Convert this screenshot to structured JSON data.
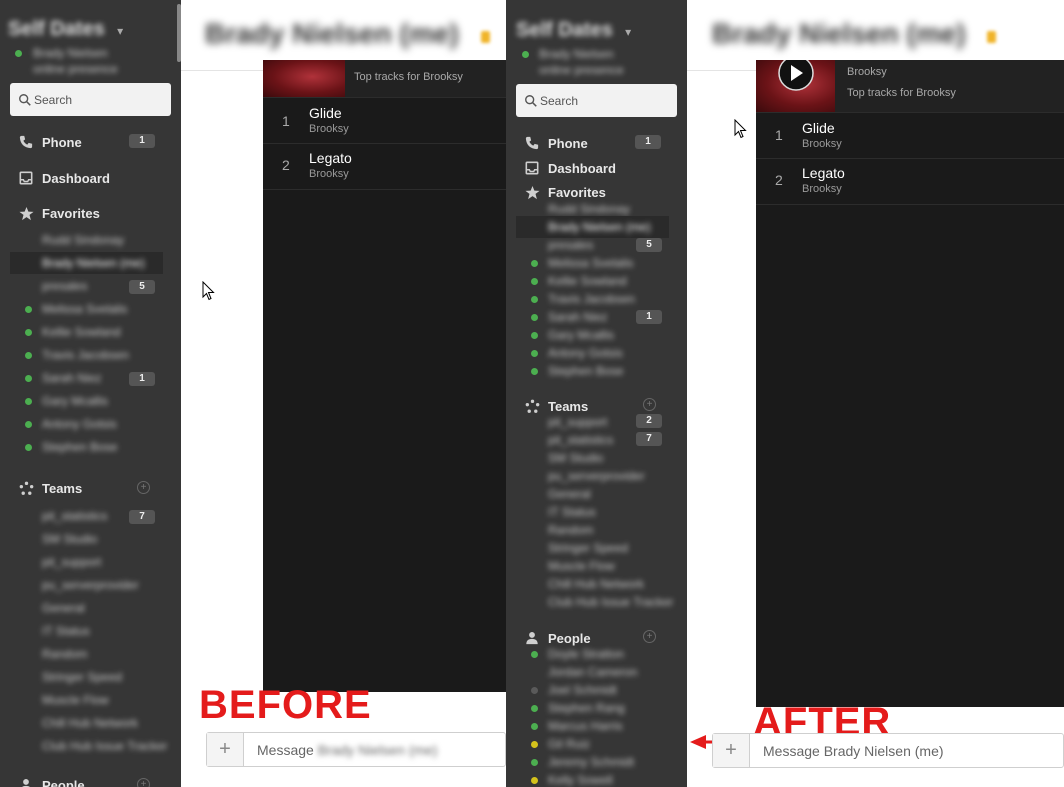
{
  "before": {
    "label": "BEFORE",
    "workspace": {
      "name": "Self Dates",
      "user": "Brady Nielsen",
      "status": "online presence"
    },
    "search_placeholder": "Search",
    "nav": [
      {
        "label": "Phone",
        "badge": "1",
        "icon": "phone-icon"
      },
      {
        "label": "Dashboard",
        "badge": "",
        "icon": "inbox-icon"
      },
      {
        "label": "Favorites",
        "badge": "",
        "icon": "star-icon"
      }
    ],
    "favorites": [
      {
        "name": "Rudd Sindonay",
        "dot": "",
        "badge": "",
        "selected": false
      },
      {
        "name": "Brady Nielsen (me)",
        "dot": "",
        "badge": "",
        "selected": true
      },
      {
        "name": "presales",
        "dot": "",
        "badge": "5",
        "selected": false
      },
      {
        "name": "Melissa Svelalis",
        "dot": "green",
        "badge": "",
        "selected": false
      },
      {
        "name": "Kellie Sowland",
        "dot": "green",
        "badge": "",
        "selected": false
      },
      {
        "name": "Travis Jacobsen",
        "dot": "green",
        "badge": "",
        "selected": false
      },
      {
        "name": "Sarah Niez",
        "dot": "green",
        "badge": "1",
        "selected": false
      },
      {
        "name": "Gary Mcallis",
        "dot": "green",
        "badge": "",
        "selected": false
      },
      {
        "name": "Antony Gotsis",
        "dot": "green",
        "badge": "",
        "selected": false
      },
      {
        "name": "Stephen Bose",
        "dot": "green",
        "badge": "",
        "selected": false
      }
    ],
    "teams_label": "Teams",
    "teams": [
      {
        "name": "pit_statistics",
        "badge": "7"
      },
      {
        "name": "SM Studio",
        "badge": ""
      },
      {
        "name": "pit_support",
        "badge": ""
      },
      {
        "name": "pu_serverprovider",
        "badge": ""
      },
      {
        "name": "General",
        "badge": ""
      },
      {
        "name": "IT Status",
        "badge": ""
      },
      {
        "name": "Random",
        "badge": ""
      },
      {
        "name": "Stringer Speed",
        "badge": ""
      },
      {
        "name": "Muscle Flow",
        "badge": ""
      },
      {
        "name": "Chill Hub Network",
        "badge": ""
      },
      {
        "name": "Club Hub Issue Tracker",
        "badge": ""
      }
    ],
    "people_label": "People",
    "channel_title": "Brady Nielsen (me)",
    "player": {
      "subtitle": "Top tracks for Brooksy",
      "tracks": [
        {
          "num": "1",
          "name": "Glide",
          "artist": "Brooksy"
        },
        {
          "num": "2",
          "name": "Legato",
          "artist": "Brooksy"
        }
      ]
    },
    "message_prefix": "Message",
    "message_target": "Brady Nielsen (me)"
  },
  "after": {
    "label": "AFTER",
    "workspace": {
      "name": "Self Dates",
      "user": "Brady Nielsen",
      "status": "online presence"
    },
    "search_placeholder": "Search",
    "nav": [
      {
        "label": "Phone",
        "badge": "1",
        "icon": "phone-icon"
      },
      {
        "label": "Dashboard",
        "badge": "",
        "icon": "inbox-icon"
      },
      {
        "label": "Favorites",
        "badge": "",
        "icon": "star-icon"
      }
    ],
    "favorites": [
      {
        "name": "Rudd Sindonay",
        "dot": "",
        "badge": "",
        "selected": false
      },
      {
        "name": "Brady Nielsen (me)",
        "dot": "",
        "badge": "",
        "selected": true
      },
      {
        "name": "presales",
        "dot": "",
        "badge": "5",
        "selected": false
      },
      {
        "name": "Melissa Svelalis",
        "dot": "green",
        "badge": "",
        "selected": false
      },
      {
        "name": "Kellie Sowland",
        "dot": "green",
        "badge": "",
        "selected": false
      },
      {
        "name": "Travis Jacobsen",
        "dot": "green",
        "badge": "",
        "selected": false
      },
      {
        "name": "Sarah Niez",
        "dot": "green",
        "badge": "1",
        "selected": false
      },
      {
        "name": "Gary Mcallis",
        "dot": "green",
        "badge": "",
        "selected": false
      },
      {
        "name": "Antony Gotsis",
        "dot": "green",
        "badge": "",
        "selected": false
      },
      {
        "name": "Stephen Bose",
        "dot": "green",
        "badge": "",
        "selected": false
      }
    ],
    "teams_label": "Teams",
    "teams": [
      {
        "name": "pit_support",
        "badge": "2"
      },
      {
        "name": "pit_statistics",
        "badge": "7"
      },
      {
        "name": "SM Studio",
        "badge": ""
      },
      {
        "name": "pu_serverprovider",
        "badge": ""
      },
      {
        "name": "General",
        "badge": ""
      },
      {
        "name": "IT Status",
        "badge": ""
      },
      {
        "name": "Random",
        "badge": ""
      },
      {
        "name": "Stringer Speed",
        "badge": ""
      },
      {
        "name": "Muscle Flow",
        "badge": ""
      },
      {
        "name": "Chill Hub Network",
        "badge": ""
      },
      {
        "name": "Club Hub Issue Tracker",
        "badge": ""
      }
    ],
    "people_label": "People",
    "people": [
      {
        "name": "Doyle Stratton",
        "dot": "green"
      },
      {
        "name": "Jordan Cameron",
        "dot": ""
      },
      {
        "name": "Joel Schmidt",
        "dot": "gray"
      },
      {
        "name": "Stephen Rang",
        "dot": "green"
      },
      {
        "name": "Marcus Harris",
        "dot": "green"
      },
      {
        "name": "Gil Ruiz",
        "dot": "yellow"
      },
      {
        "name": "Jeremy Schmidt",
        "dot": "green"
      },
      {
        "name": "Kelly Sowell",
        "dot": "yellow"
      }
    ],
    "channel_title": "Brady Nielsen (me)",
    "player": {
      "artist": "Brooksy",
      "subtitle": "Top tracks for Brooksy",
      "tracks": [
        {
          "num": "1",
          "name": "Glide",
          "artist": "Brooksy"
        },
        {
          "num": "2",
          "name": "Legato",
          "artist": "Brooksy"
        }
      ]
    },
    "message_prefix": "Message",
    "message_target": "Brady Nielsen (me)"
  },
  "colors": {
    "sidebar": "#363636",
    "player": "#1a1a1a",
    "annotation": "#e41b1b",
    "presence_green": "#4caf50",
    "presence_yellow": "#d4c21c"
  }
}
